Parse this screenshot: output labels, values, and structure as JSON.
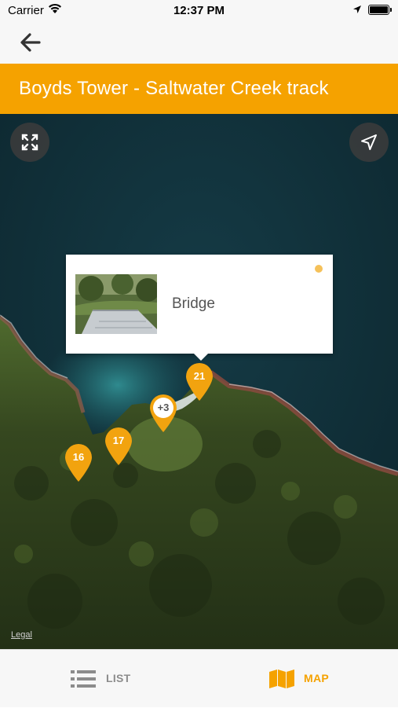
{
  "status_bar": {
    "carrier": "Carrier",
    "time": "12:37 PM"
  },
  "nav": {
    "back_icon": "arrow-left-icon"
  },
  "header": {
    "title": "Boyds Tower - Saltwater Creek track",
    "accent_color": "#f5a200"
  },
  "map": {
    "callout": {
      "label": "Bridge"
    },
    "pins": [
      {
        "label": "21"
      },
      {
        "label": "+3"
      },
      {
        "label": "17"
      },
      {
        "label": "16"
      }
    ],
    "legal_link": "Legal",
    "fullscreen_icon": "expand-icon",
    "locate_icon": "location-arrow-icon"
  },
  "tabs": [
    {
      "label": "LIST",
      "icon": "list-icon",
      "active": false
    },
    {
      "label": "MAP",
      "icon": "map-icon",
      "active": true
    }
  ]
}
